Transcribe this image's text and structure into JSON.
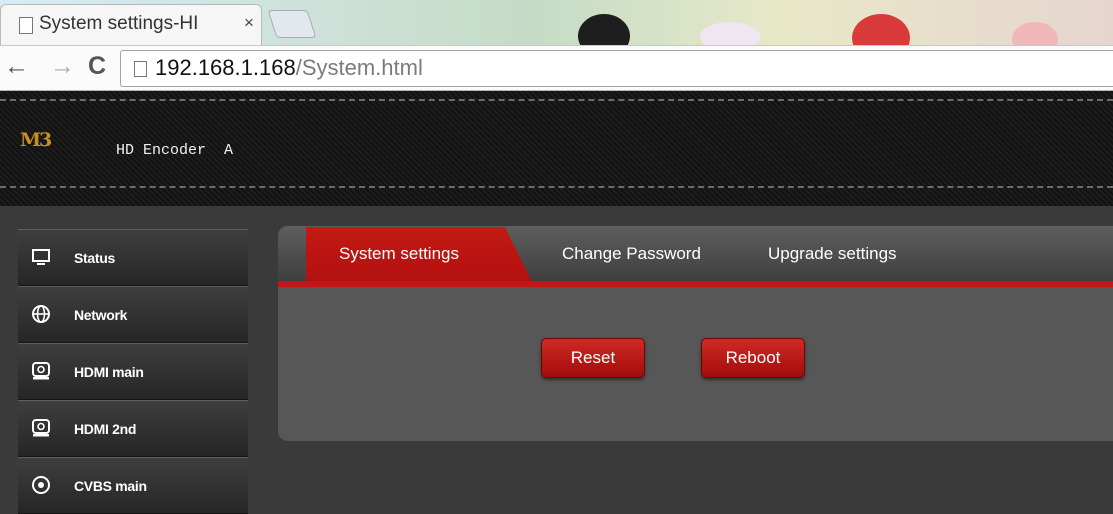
{
  "browser": {
    "tab_title": "System settings-HI",
    "tab_close": "×",
    "nav_back": "←",
    "nav_forward": "→",
    "nav_reload": "C",
    "url_host": "192.168.1.168",
    "url_path": "/System.html"
  },
  "header": {
    "logo_text": "M3",
    "device_name": "HD Encoder  A",
    "accent_color": "#c41616"
  },
  "sidebar": {
    "items": [
      {
        "label": "Status",
        "icon": "monitor-icon"
      },
      {
        "label": "Network",
        "icon": "globe-icon"
      },
      {
        "label": "HDMI main",
        "icon": "hdmi-icon"
      },
      {
        "label": "HDMI 2nd",
        "icon": "hdmi-icon"
      },
      {
        "label": "CVBS main",
        "icon": "target-icon"
      }
    ]
  },
  "main": {
    "tabs": [
      {
        "label": "System settings",
        "active": true
      },
      {
        "label": "Change Password",
        "active": false
      },
      {
        "label": "Upgrade settings",
        "active": false
      }
    ],
    "buttons": {
      "reset_label": "Reset",
      "reboot_label": "Reboot"
    }
  }
}
